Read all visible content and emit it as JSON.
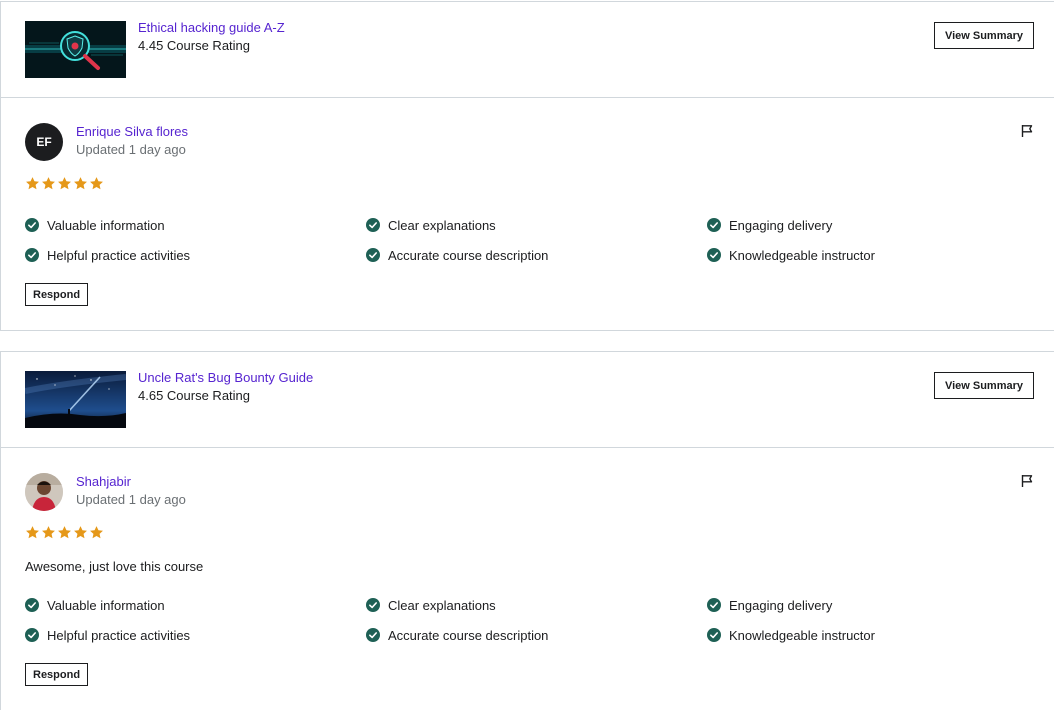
{
  "colors": {
    "link": "#5624d0",
    "star": "#e59819",
    "check": "#1e6055",
    "border": "#d1d7dc",
    "muted": "#6a6f73"
  },
  "reviews": [
    {
      "course": {
        "title": "Ethical hacking guide A-Z",
        "rating": "4.45 Course Rating",
        "summary_label": "View Summary"
      },
      "reviewer": {
        "initials": "EF",
        "name": "Enrique Silva flores",
        "updated": "Updated 1 day ago"
      },
      "stars": 5,
      "comment": "",
      "tags": [
        "Valuable information",
        "Clear explanations",
        "Engaging delivery",
        "Helpful practice activities",
        "Accurate course description",
        "Knowledgeable instructor"
      ],
      "respond_label": "Respond"
    },
    {
      "course": {
        "title": "Uncle Rat's Bug Bounty Guide",
        "rating": "4.65 Course Rating",
        "summary_label": "View Summary"
      },
      "reviewer": {
        "initials": "",
        "name": "Shahjabir",
        "updated": "Updated 1 day ago"
      },
      "stars": 5,
      "comment": "Awesome, just love this course",
      "tags": [
        "Valuable information",
        "Clear explanations",
        "Engaging delivery",
        "Helpful practice activities",
        "Accurate course description",
        "Knowledgeable instructor"
      ],
      "respond_label": "Respond"
    }
  ],
  "icons": {
    "flag": "flag-icon",
    "check": "check-circle-icon",
    "star": "star-icon"
  }
}
